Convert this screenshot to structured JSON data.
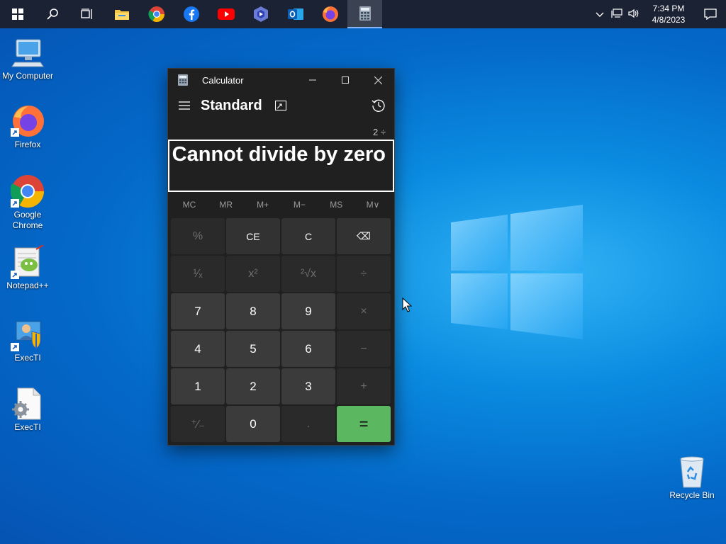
{
  "taskbar": {
    "time": "7:34 PM",
    "date": "4/8/2023"
  },
  "desktop": {
    "icons": [
      {
        "label": "My Computer"
      },
      {
        "label": "Firefox"
      },
      {
        "label": "Google Chrome"
      },
      {
        "label": "Notepad++"
      },
      {
        "label": "ExecTI"
      },
      {
        "label": "ExecTI"
      },
      {
        "label": "Recycle Bin"
      }
    ]
  },
  "calculator": {
    "title": "Calculator",
    "mode": "Standard",
    "expression": "2 ÷",
    "display": "Cannot divide by zero",
    "memory": [
      "MC",
      "MR",
      "M+",
      "M−",
      "MS",
      "M∨"
    ],
    "keys": [
      "%",
      "CE",
      "C",
      "⌫",
      "¹⁄ₓ",
      "x²",
      "²√x",
      "÷",
      "7",
      "8",
      "9",
      "×",
      "4",
      "5",
      "6",
      "−",
      "1",
      "2",
      "3",
      "+",
      "⁺⁄₋",
      "0",
      ".",
      "="
    ]
  },
  "colors": {
    "accent_equals": "#5bb760",
    "taskbar": "#1b2233",
    "calc_bg": "#202020"
  }
}
